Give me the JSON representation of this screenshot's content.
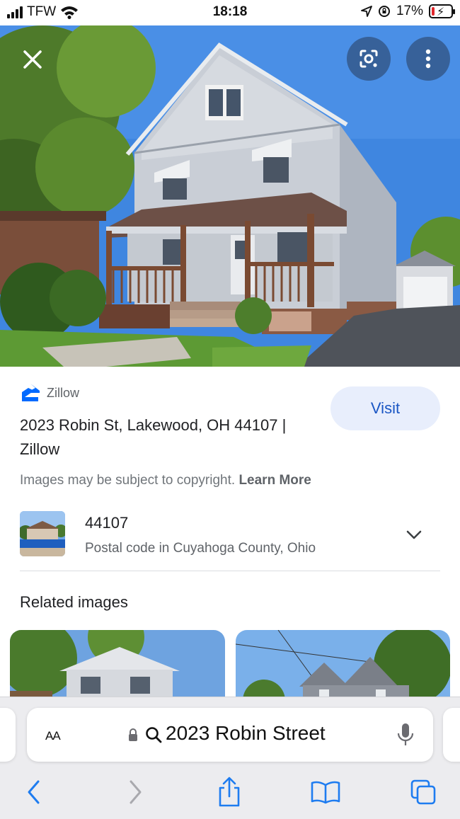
{
  "status_bar": {
    "carrier": "TFW",
    "time": "18:18",
    "battery_percent": "17%",
    "battery_level": 0.17,
    "icons": [
      "signal-icon",
      "wifi-icon",
      "location-icon",
      "orientation-lock-icon",
      "battery-charging-icon"
    ]
  },
  "viewer": {
    "close_icon": "close-icon",
    "lens_icon": "google-lens-icon",
    "more_icon": "more-vertical-icon"
  },
  "result": {
    "source_name": "Zillow",
    "title": "2023 Robin St, Lakewood, OH 44107 | Zillow",
    "visit_label": "Visit",
    "copyright_text": "Images may be subject to copyright.",
    "learn_more_label": "Learn More"
  },
  "entity": {
    "title": "44107",
    "subtitle": "Postal code in Cuyahoga County, Ohio"
  },
  "related": {
    "heading": "Related images"
  },
  "browser": {
    "aa_label": "AA",
    "url_text": "2023 Robin Street",
    "toolbar_icons": [
      "back-icon",
      "forward-icon",
      "share-icon",
      "bookmarks-icon",
      "tabs-icon"
    ]
  },
  "colors": {
    "accent": "#1a56c4",
    "visit_bg": "#e8eefc",
    "toolbar_blue": "#1e7cf0",
    "zillow_blue": "#006aff"
  }
}
